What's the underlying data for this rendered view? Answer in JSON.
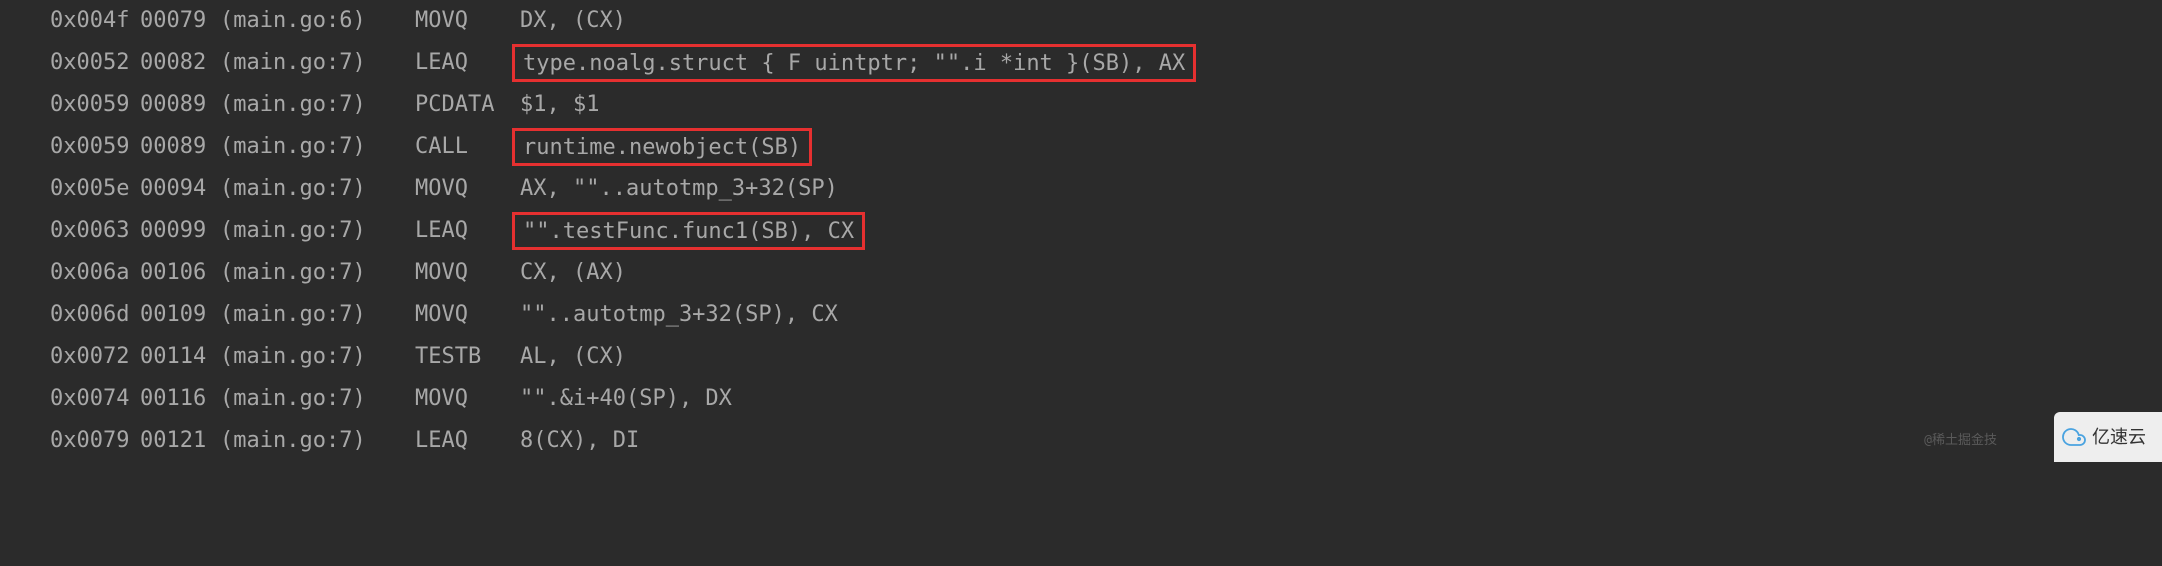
{
  "lines": [
    {
      "hex": "0x004f",
      "dec": "00079",
      "loc": "(main.go:6)",
      "op": "MOVQ",
      "arg": "DX, (CX)",
      "highlight": false
    },
    {
      "hex": "0x0052",
      "dec": "00082",
      "loc": "(main.go:7)",
      "op": "LEAQ",
      "arg": "type.noalg.struct { F uintptr; \"\".i *int }(SB), AX",
      "highlight": true
    },
    {
      "hex": "0x0059",
      "dec": "00089",
      "loc": "(main.go:7)",
      "op": "PCDATA",
      "arg": "$1, $1",
      "highlight": false
    },
    {
      "hex": "0x0059",
      "dec": "00089",
      "loc": "(main.go:7)",
      "op": "CALL",
      "arg": "runtime.newobject(SB)",
      "highlight": true
    },
    {
      "hex": "0x005e",
      "dec": "00094",
      "loc": "(main.go:7)",
      "op": "MOVQ",
      "arg": "AX, \"\"..autotmp_3+32(SP)",
      "highlight": false
    },
    {
      "hex": "0x0063",
      "dec": "00099",
      "loc": "(main.go:7)",
      "op": "LEAQ",
      "arg": "\"\".testFunc.func1(SB), CX",
      "highlight": true
    },
    {
      "hex": "0x006a",
      "dec": "00106",
      "loc": "(main.go:7)",
      "op": "MOVQ",
      "arg": "CX, (AX)",
      "highlight": false
    },
    {
      "hex": "0x006d",
      "dec": "00109",
      "loc": "(main.go:7)",
      "op": "MOVQ",
      "arg": "\"\"..autotmp_3+32(SP), CX",
      "highlight": false
    },
    {
      "hex": "0x0072",
      "dec": "00114",
      "loc": "(main.go:7)",
      "op": "TESTB",
      "arg": "AL, (CX)",
      "highlight": false
    },
    {
      "hex": "0x0074",
      "dec": "00116",
      "loc": "(main.go:7)",
      "op": "MOVQ",
      "arg": "\"\".&i+40(SP), DX",
      "highlight": false
    },
    {
      "hex": "0x0079",
      "dec": "00121",
      "loc": "(main.go:7)",
      "op": "LEAQ",
      "arg": "8(CX), DI",
      "highlight": false
    }
  ],
  "watermark_left": "@稀土掘金技",
  "watermark_right": "亿速云"
}
